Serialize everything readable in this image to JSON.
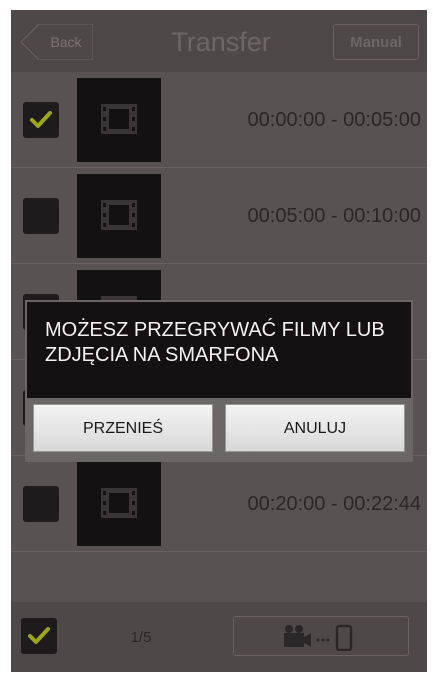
{
  "header": {
    "back_label": "Back",
    "title": "Transfer",
    "manual_label": "Manual"
  },
  "rows": [
    {
      "time": "00:00:00 - 00:05:00",
      "checked": true
    },
    {
      "time": "00:05:00 - 00:10:00",
      "checked": false
    },
    {
      "time": "",
      "checked": false
    },
    {
      "time": "",
      "checked": false
    },
    {
      "time": "00:20:00 - 00:22:44",
      "checked": false
    }
  ],
  "footer": {
    "page_indicator": "1/5",
    "select_all_checked": true
  },
  "dialog": {
    "message": "MOŻESZ PRZEGRYWAĆ FILMY LUB ZDJĘCIA NA SMARFONA",
    "confirm_label": "PRZENIEŚ",
    "cancel_label": "ANULUJ"
  },
  "icons": {
    "checkmark": "checkmark-icon",
    "thumbnail": "film-icon",
    "transfer": "camera-to-phone-icon"
  },
  "colors": {
    "checkmark": "#9aa61c",
    "dim_background": "#595253"
  }
}
